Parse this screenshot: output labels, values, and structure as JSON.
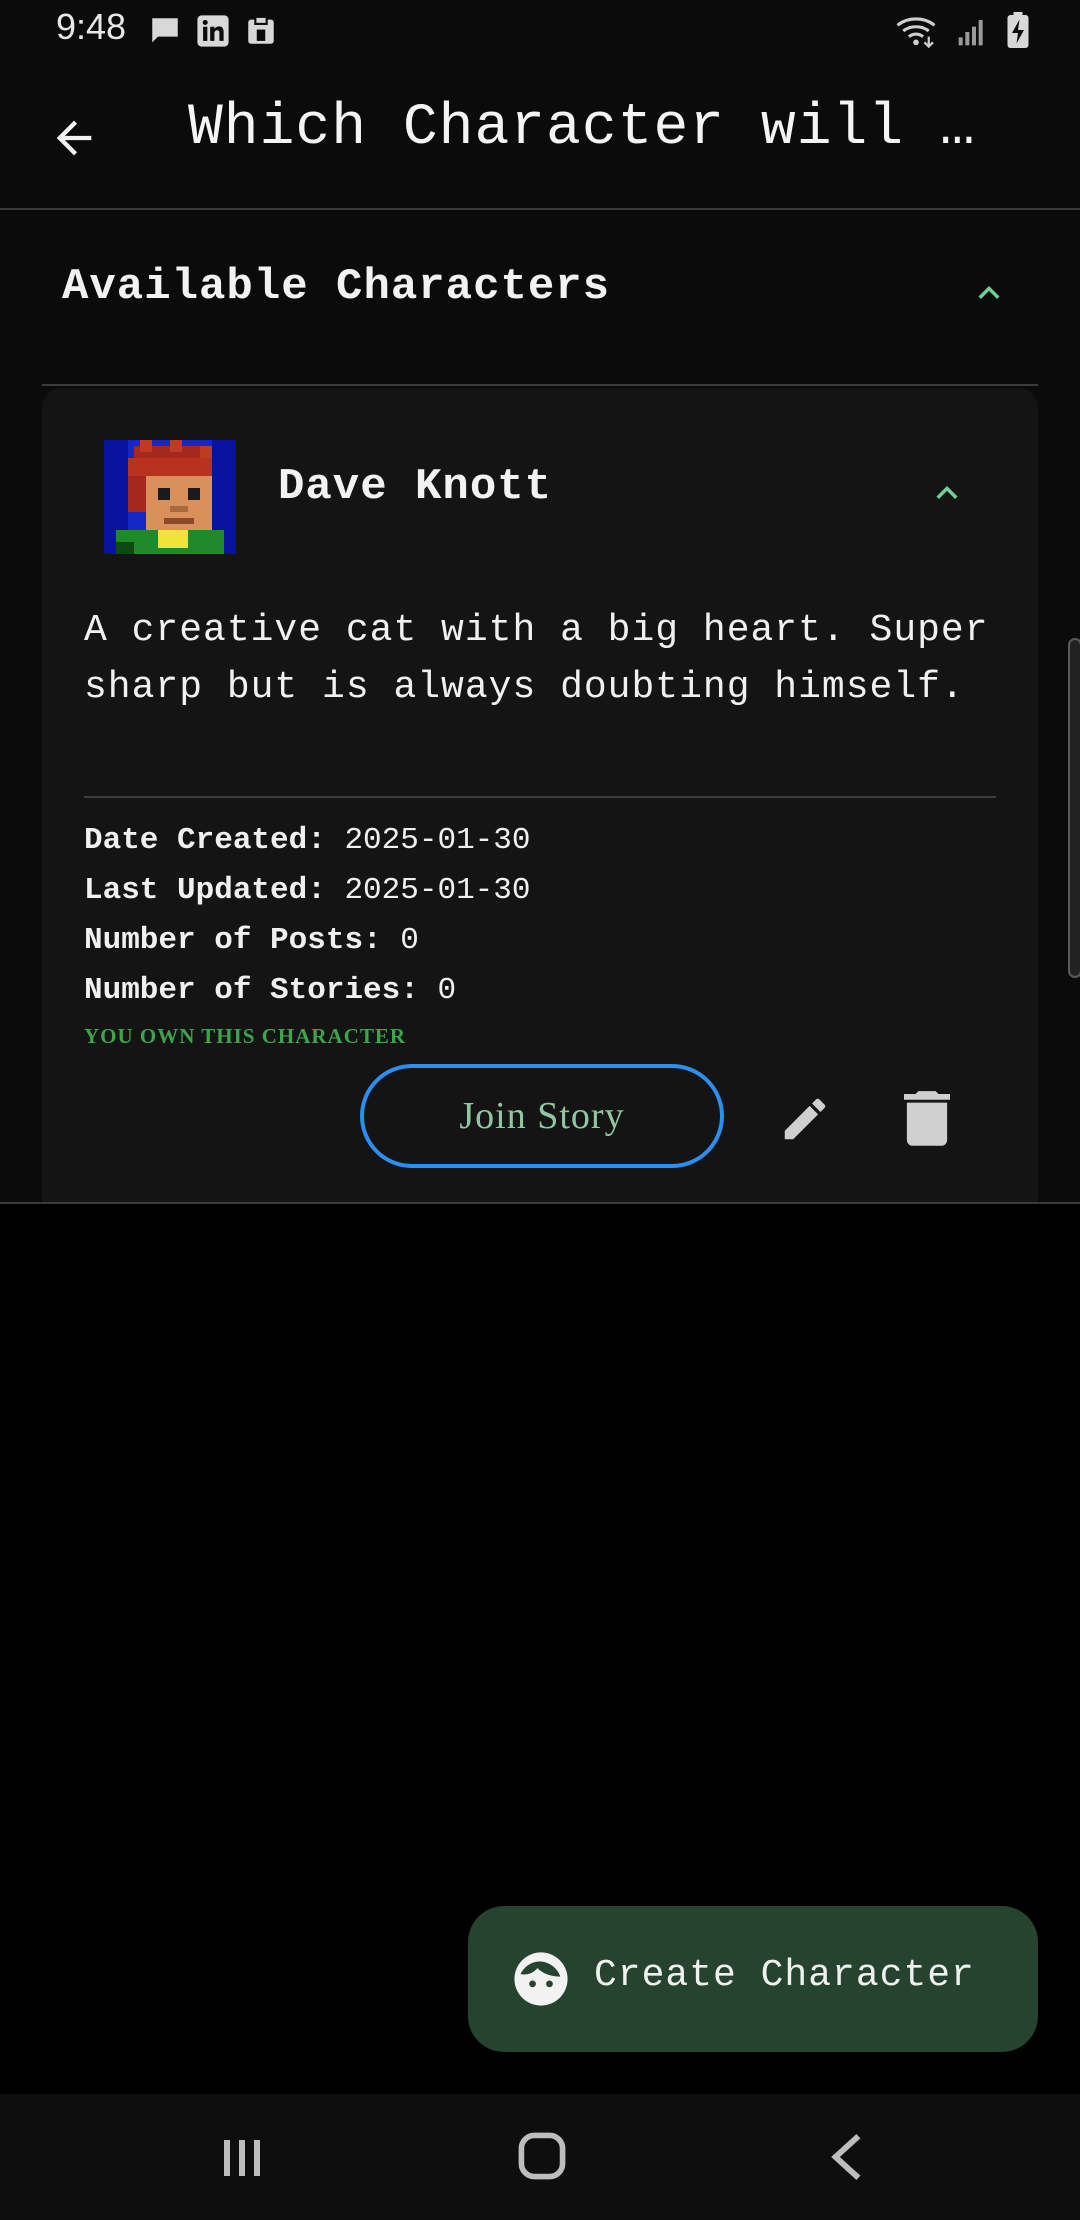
{
  "status_bar": {
    "time": "9:48",
    "left_icons": [
      "chat-icon",
      "linkedin-icon",
      "clipboard-icon"
    ],
    "right_icons": [
      "wifi-icon",
      "signal-icon",
      "battery-charging-icon"
    ]
  },
  "app_bar": {
    "back_icon": "arrow-back-icon",
    "title": "Which Character will …"
  },
  "section": {
    "title": "Available Characters",
    "expanded": true
  },
  "character": {
    "name": "Dave Knott",
    "description": "A creative cat with a big heart. Super sharp but is always doubting himself.",
    "date_created_label": "Date Created:",
    "date_created": "2025-01-30",
    "last_updated_label": "Last Updated:",
    "last_updated": "2025-01-30",
    "posts_label": "Number of Posts:",
    "posts": "0",
    "stories_label": "Number of Stories:",
    "stories": "0",
    "ownership": "YOU OWN THIS CHARACTER",
    "join_label": "Join Story"
  },
  "fab": {
    "icon": "face-icon",
    "label": "Create Character"
  },
  "colors": {
    "accent_green": "#3fa34d",
    "fab_bg": "#26432f",
    "join_border": "#2b8ef0",
    "chevron": "#6fcf97"
  }
}
